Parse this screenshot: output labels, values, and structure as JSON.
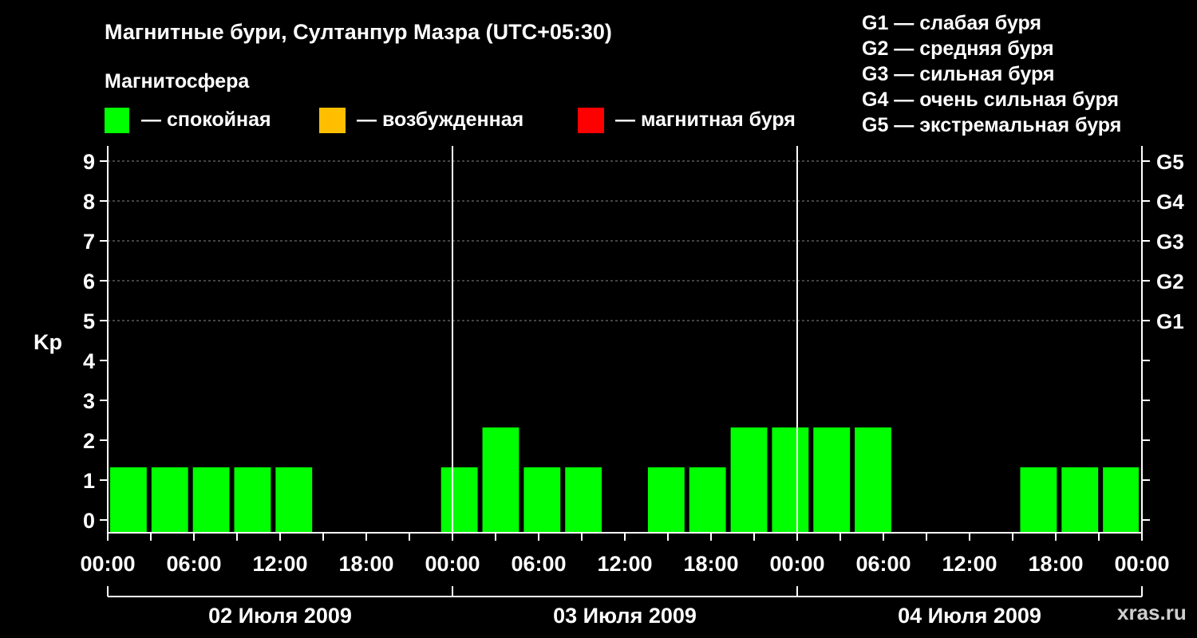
{
  "header": {
    "title": "Магнитные бури, Султанпур Мазра (UTC+05:30)",
    "subtitle": "Магнитосфера",
    "watermark": "xras.ru"
  },
  "legend": [
    {
      "label": "— спокойная",
      "color": "#00ff00"
    },
    {
      "label": "— возбужденная",
      "color": "#ffbf00"
    },
    {
      "label": "— магнитная буря",
      "color": "#ff0000"
    }
  ],
  "storm_scale": [
    "G1 — слабая буря",
    "G2 — средняя буря",
    "G3 — сильная буря",
    "G4 — очень сильная буря",
    "G5 — экстремальная буря"
  ],
  "chart_data": {
    "type": "bar",
    "ylabel": "Kp",
    "ylim": [
      0,
      9
    ],
    "yticks": [
      0,
      1,
      2,
      3,
      4,
      5,
      6,
      7,
      8,
      9
    ],
    "right_axis": [
      {
        "level": 5,
        "label": "G1"
      },
      {
        "level": 6,
        "label": "G2"
      },
      {
        "level": 7,
        "label": "G3"
      },
      {
        "level": 8,
        "label": "G4"
      },
      {
        "level": 9,
        "label": "G5"
      }
    ],
    "grid_levels": [
      5,
      6,
      7,
      8,
      9
    ],
    "x_tick_labels": [
      "00:00",
      "06:00",
      "12:00",
      "18:00",
      "00:00",
      "06:00",
      "12:00",
      "18:00",
      "00:00",
      "06:00",
      "12:00",
      "18:00",
      "00:00"
    ],
    "days": [
      "02 Июля 2009",
      "03 Июля 2009",
      "04 Июля 2009"
    ],
    "interval_hours": 3,
    "values": [
      1,
      1,
      1,
      1,
      1,
      null,
      null,
      null,
      1,
      2,
      1,
      1,
      null,
      1,
      1,
      2,
      2,
      2,
      2,
      null,
      null,
      null,
      1,
      1,
      1
    ],
    "quiet_color": "#00ff00"
  }
}
